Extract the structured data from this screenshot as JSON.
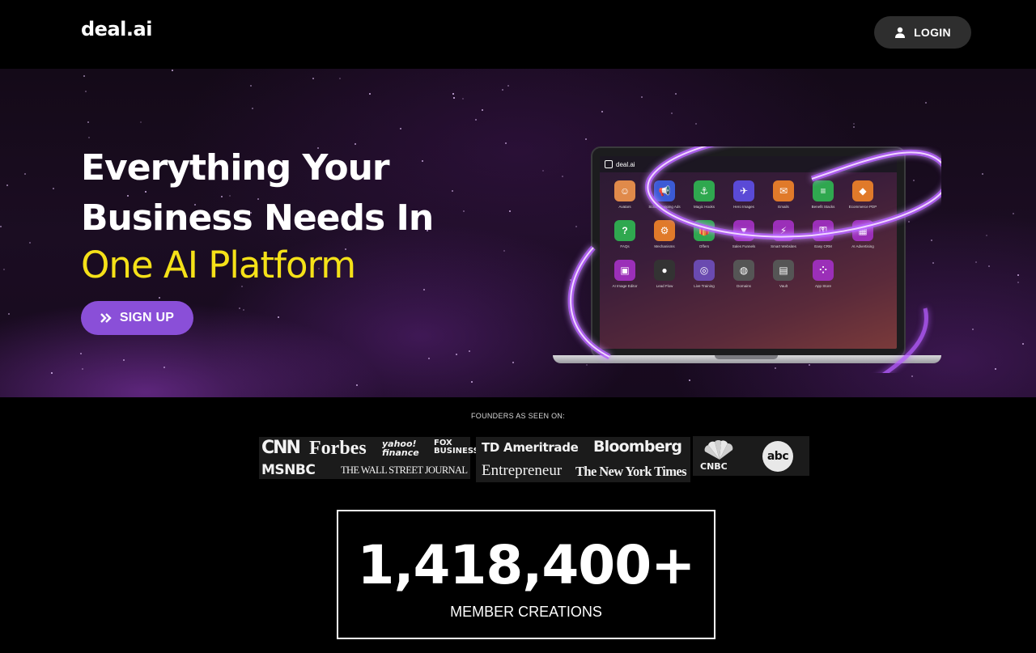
{
  "header": {
    "logo": "deal.ai",
    "login_label": "LOGIN"
  },
  "hero": {
    "title_line1": "Everything Your",
    "title_line2": "Business Needs In",
    "subtitle": "One AI Platform",
    "signup_label": "SIGN UP",
    "colors": {
      "subtitle": "#f5e118",
      "signup": "#8a4fd8"
    }
  },
  "laptop": {
    "brand": "deal.ai",
    "apps": [
      {
        "label": "Avatars",
        "color": "#e08a4a",
        "glyph": "☺"
      },
      {
        "label": "Scroll-Stopping Ads",
        "color": "#3b5bd6",
        "glyph": "📢"
      },
      {
        "label": "Magic Hooks",
        "color": "#2fa84f",
        "glyph": "⚓"
      },
      {
        "label": "Hero Images",
        "color": "#5a4ad6",
        "glyph": "✈"
      },
      {
        "label": "Emails",
        "color": "#e07a2a",
        "glyph": "✉"
      },
      {
        "label": "Benefit Stacks",
        "color": "#2fa84f",
        "glyph": "≡"
      },
      {
        "label": "Ecommerce PDP",
        "color": "#e07a2a",
        "glyph": "◆"
      },
      {
        "label": "FAQs",
        "color": "#2fa84f",
        "glyph": "?"
      },
      {
        "label": "Mechanisms",
        "color": "#e07a2a",
        "glyph": "⚙"
      },
      {
        "label": "Offers",
        "color": "#2fa84f",
        "glyph": "🎁"
      },
      {
        "label": "Sales Funnels",
        "color": "#9b2fb8",
        "glyph": "▼"
      },
      {
        "label": "Smart Websites",
        "color": "#9b2fb8",
        "glyph": "⚡"
      },
      {
        "label": "Easy CRM",
        "color": "#9b2fb8",
        "glyph": "⚿"
      },
      {
        "label": "AI Advertising",
        "color": "#9b2fb8",
        "glyph": "▦"
      },
      {
        "label": "AI Image Editor",
        "color": "#9b2fb8",
        "glyph": "▣"
      },
      {
        "label": "Lead Flow",
        "color": "#333333",
        "glyph": "●"
      },
      {
        "label": "Live Training",
        "color": "#6a4ab0",
        "glyph": "◎"
      },
      {
        "label": "Domains",
        "color": "#555555",
        "glyph": "◍"
      },
      {
        "label": "Vault",
        "color": "#555555",
        "glyph": "▤"
      },
      {
        "label": "App Store",
        "color": "#9b2fb8",
        "glyph": "⁘"
      }
    ]
  },
  "press": {
    "label": "FOUNDERS AS SEEN ON:",
    "outlets": [
      "CNN",
      "Forbes",
      "yahoo! finance",
      "FOX BUSINESS",
      "MSNBC",
      "THE WALL STREET JOURNAL",
      "TD Ameritrade",
      "Bloomberg",
      "Entrepreneur",
      "The New York Times",
      "CNBC",
      "abc"
    ]
  },
  "stats": {
    "count": "1,418,400+",
    "label": "MEMBER CREATIONS"
  }
}
